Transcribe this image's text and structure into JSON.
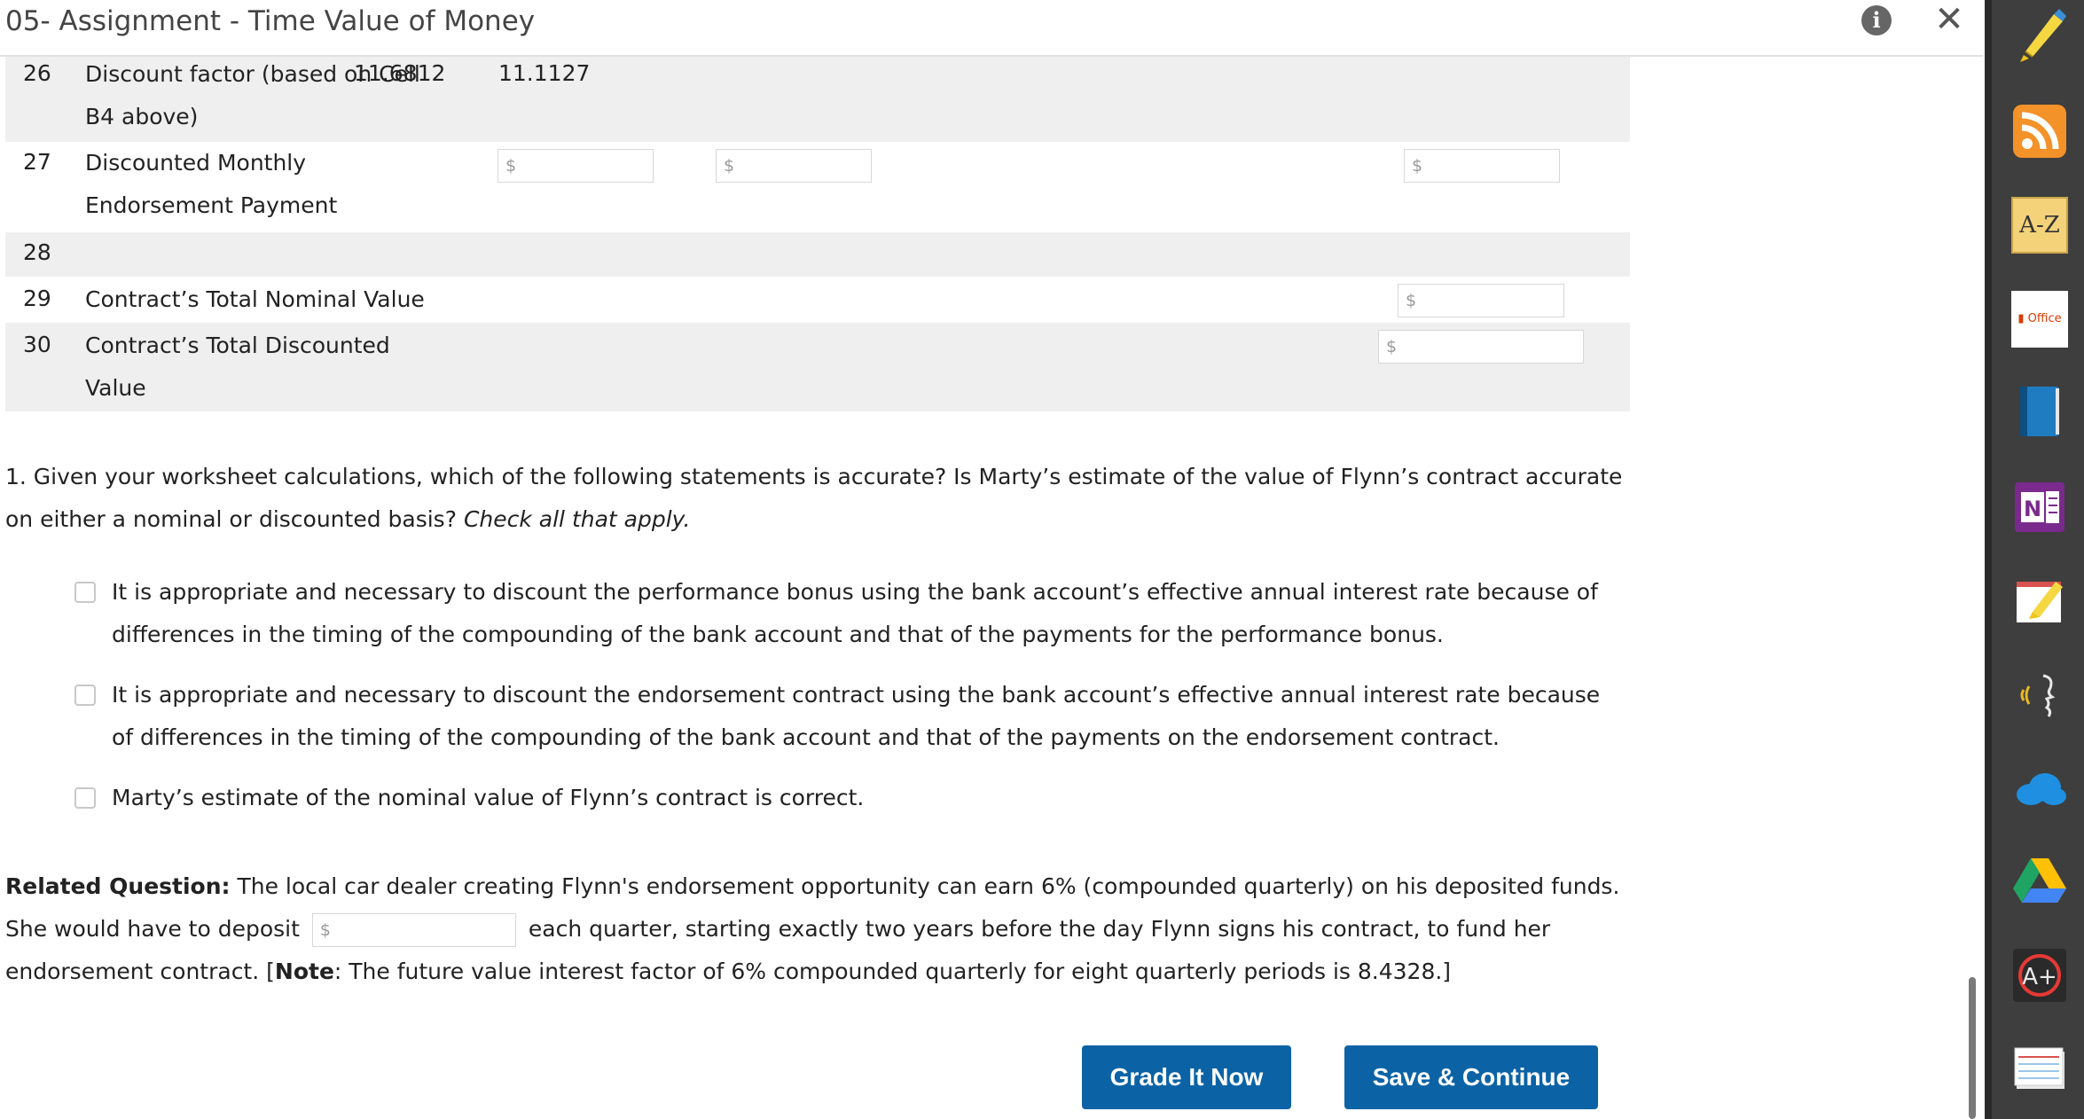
{
  "window": {
    "title": "05- Assignment - Time Value of Money"
  },
  "table": {
    "rows": [
      {
        "num": "26",
        "label": "Discount factor (based on Cell B4 above)",
        "col1": "11.6812",
        "col2": "11.1127"
      },
      {
        "num": "27",
        "label": "Discounted Monthly Endorsement Payment",
        "input_prefix": "$"
      },
      {
        "num": "28",
        "label": ""
      },
      {
        "num": "29",
        "label": "Contract’s Total Nominal Value",
        "input_prefix": "$"
      },
      {
        "num": "30",
        "label": "Contract’s Total Discounted Value",
        "input_prefix": "$"
      }
    ]
  },
  "question": {
    "text": "1. Given your worksheet calculations, which of the following statements is accurate? Is Marty’s estimate of the value of Flynn’s contract accurate on either a nominal or discounted basis?",
    "hint": "Check all that apply.",
    "options": [
      "It is appropriate and necessary to discount the performance bonus using the bank account’s effective annual interest rate because of differences in the timing of the compounding of the bank account and that of the payments for the performance bonus.",
      "It is appropriate and necessary to discount the endorsement contract using the bank account’s effective annual interest rate because of differences in the timing of the compounding of the bank account and that of the payments on the endorsement contract.",
      "Marty’s estimate of the nominal value of Flynn’s contract is correct."
    ]
  },
  "related": {
    "label": "Related Question:",
    "text1": "The local car dealer creating Flynn's endorsement opportunity can earn 6% (compounded quarterly) on his deposited funds. She would have to deposit",
    "input_prefix": "$",
    "text2": "each quarter, starting exactly two years before the day Flynn signs his contract, to fund her endorsement contract. [",
    "note_label": "Note",
    "text3": ": The future value interest factor of 6% compounded quarterly for eight quarterly periods is 8.4328.]"
  },
  "buttons": {
    "grade": "Grade It Now",
    "save": "Save & Continue"
  },
  "toolbar": {
    "tools": [
      "highlighter-icon",
      "rss-icon",
      "dictionary-icon",
      "office-icon",
      "book-icon",
      "onenote-icon",
      "notes-icon",
      "text-to-speech-icon",
      "onedrive-icon",
      "google-drive-icon",
      "grade-icon",
      "notecards-icon"
    ],
    "az_label": "A-Z",
    "office_label": "Office",
    "onenote_label": "N"
  },
  "colors": {
    "button": "#0b63a5",
    "toolbar": "#3e3e3e",
    "row_shade": "#efefef"
  }
}
